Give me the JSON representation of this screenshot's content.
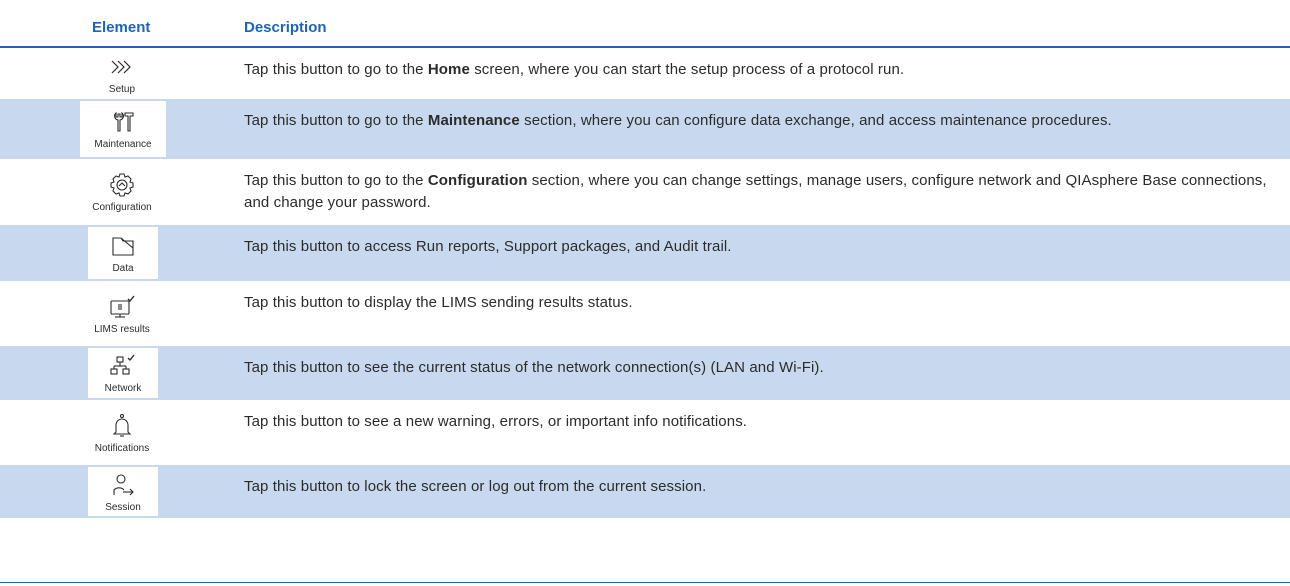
{
  "header": {
    "element": "Element",
    "description": "Description"
  },
  "rows": [
    {
      "label": "Setup",
      "icon": "setup-chevrons-icon",
      "pre": "Tap this button to go to the ",
      "bold": "Home",
      "post": " screen, where you can start the setup process of a protocol run."
    },
    {
      "label": "Maintenance",
      "icon": "maintenance-tools-icon",
      "pre": "Tap this button to go to the ",
      "bold": "Maintenance",
      "post": " section, where you can configure data exchange, and access maintenance procedures."
    },
    {
      "label": "Configuration",
      "icon": "configuration-gear-icon",
      "pre": "Tap this button to go to the ",
      "bold": "Configuration",
      "post": " section, where you can change settings, manage users, configure network and QIAsphere Base connections, and change your password."
    },
    {
      "label": "Data",
      "icon": "data-folder-icon",
      "pre": "Tap this button to access Run reports, Support packages, and Audit trail.",
      "bold": "",
      "post": ""
    },
    {
      "label": "LIMS results",
      "icon": "lims-monitor-check-icon",
      "pre": "Tap this button to display the LIMS sending results status.",
      "bold": "",
      "post": ""
    },
    {
      "label": "Network",
      "icon": "network-tree-check-icon",
      "pre": "Tap this button to see the current status of the network connection(s) (LAN and Wi-Fi).",
      "bold": "",
      "post": ""
    },
    {
      "label": "Notifications",
      "icon": "bell-icon",
      "pre": "Tap this button to see a new warning, errors, or important info notifications.",
      "bold": "",
      "post": ""
    },
    {
      "label": "Session",
      "icon": "user-logout-icon",
      "pre": "Tap this button to lock the screen or log out from the current session.",
      "bold": "",
      "post": ""
    }
  ]
}
